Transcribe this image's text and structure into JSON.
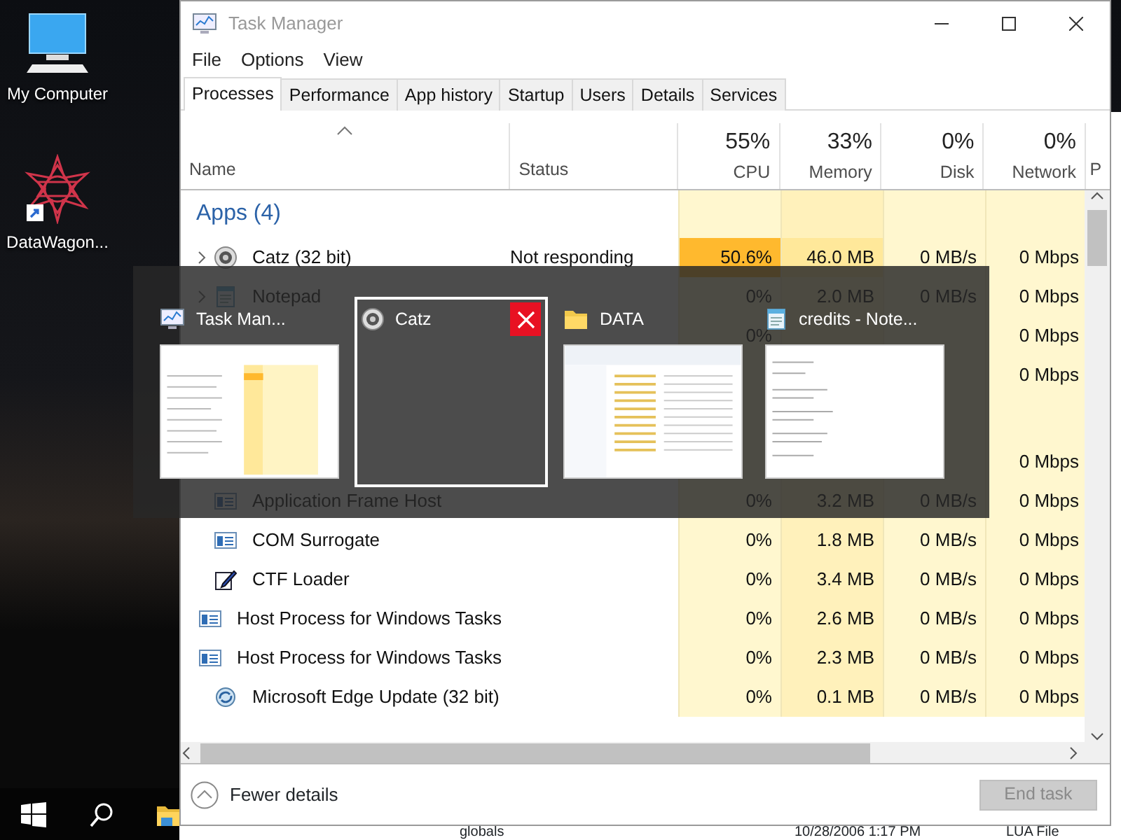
{
  "desktop": {
    "icons": [
      {
        "label": "My Computer"
      },
      {
        "label": "DataWagon..."
      }
    ]
  },
  "window": {
    "title": "Task Manager",
    "menu": [
      "File",
      "Options",
      "View"
    ],
    "tabs": [
      {
        "label": "Processes",
        "selected": true
      },
      {
        "label": "Performance",
        "selected": false
      },
      {
        "label": "App history",
        "selected": false
      },
      {
        "label": "Startup",
        "selected": false
      },
      {
        "label": "Users",
        "selected": false
      },
      {
        "label": "Details",
        "selected": false
      },
      {
        "label": "Services",
        "selected": false
      }
    ],
    "columns": [
      {
        "label": "Name",
        "sorted": true
      },
      {
        "label": "Status",
        "sorted": false
      },
      {
        "label": "CPU",
        "usage": "55%",
        "sorted": false
      },
      {
        "label": "Memory",
        "usage": "33%",
        "sorted": false
      },
      {
        "label": "Disk",
        "usage": "0%",
        "sorted": false
      },
      {
        "label": "Network",
        "usage": "0%",
        "sorted": false
      },
      {
        "label": "P",
        "sorted": false
      }
    ],
    "rows": [
      {
        "kind": "group",
        "label": "Apps (4)"
      },
      {
        "kind": "app",
        "expandable": true,
        "busy": true,
        "name": "Catz (32 bit)",
        "status": "Not responding",
        "cpu": "50.6%",
        "memory": "46.0 MB",
        "disk": "0 MB/s",
        "network": "0 Mbps"
      },
      {
        "kind": "notepad",
        "expandable": true,
        "busy": false,
        "name": "Notepad",
        "cpu": "0%",
        "memory": "2.0 MB",
        "disk": "0 MB/s",
        "network": "0 Mbps"
      },
      {
        "kind": "process",
        "expandable": false,
        "busy": false,
        "cpu": "0%",
        "network": "0 Mbps"
      },
      {
        "kind": "process",
        "expandable": false,
        "busy": false,
        "network": "0 Mbps"
      },
      {
        "kind": "group"
      },
      {
        "kind": "process",
        "expandable": false,
        "busy": false,
        "network": "0 Mbps"
      },
      {
        "kind": "service",
        "expandable": false,
        "busy": false,
        "name": "Application Frame Host",
        "cpu": "0%",
        "memory": "3.2 MB",
        "disk": "0 MB/s",
        "network": "0 Mbps"
      },
      {
        "kind": "service",
        "expandable": false,
        "busy": false,
        "name": "COM Surrogate",
        "cpu": "0%",
        "memory": "1.8 MB",
        "disk": "0 MB/s",
        "network": "0 Mbps"
      },
      {
        "kind": "loader",
        "expandable": false,
        "busy": false,
        "name": "CTF Loader",
        "cpu": "0%",
        "memory": "3.4 MB",
        "disk": "0 MB/s",
        "network": "0 Mbps"
      },
      {
        "kind": "service",
        "expandable": false,
        "busy": false,
        "name": "Host Process for Windows Tasks",
        "cpu": "0%",
        "memory": "2.6 MB",
        "disk": "0 MB/s",
        "network": "0 Mbps"
      },
      {
        "kind": "service",
        "expandable": false,
        "busy": false,
        "name": "Host Process for Windows Tasks",
        "cpu": "0%",
        "memory": "2.3 MB",
        "disk": "0 MB/s",
        "network": "0 Mbps"
      },
      {
        "kind": "updater",
        "expandable": false,
        "busy": false,
        "name": "Microsoft Edge Update (32 bit)",
        "cpu": "0%",
        "memory": "0.1 MB",
        "disk": "0 MB/s",
        "network": "0 Mbps"
      }
    ],
    "footer": {
      "toggle": "Fewer details",
      "end_task": {
        "label": "End task",
        "disabled": true
      }
    }
  },
  "switcher": {
    "items": [
      {
        "kind": "monitor",
        "title": "Task Man...",
        "selected": false
      },
      {
        "kind": "app",
        "title": "Catz",
        "selected": true
      },
      {
        "kind": "folder",
        "title": "DATA",
        "selected": false
      },
      {
        "kind": "notepad",
        "title": "credits - Note...",
        "selected": false
      }
    ]
  },
  "background_window": {
    "cells": [
      "globals",
      "10/28/2006 1:17 PM",
      "LUA File"
    ]
  }
}
